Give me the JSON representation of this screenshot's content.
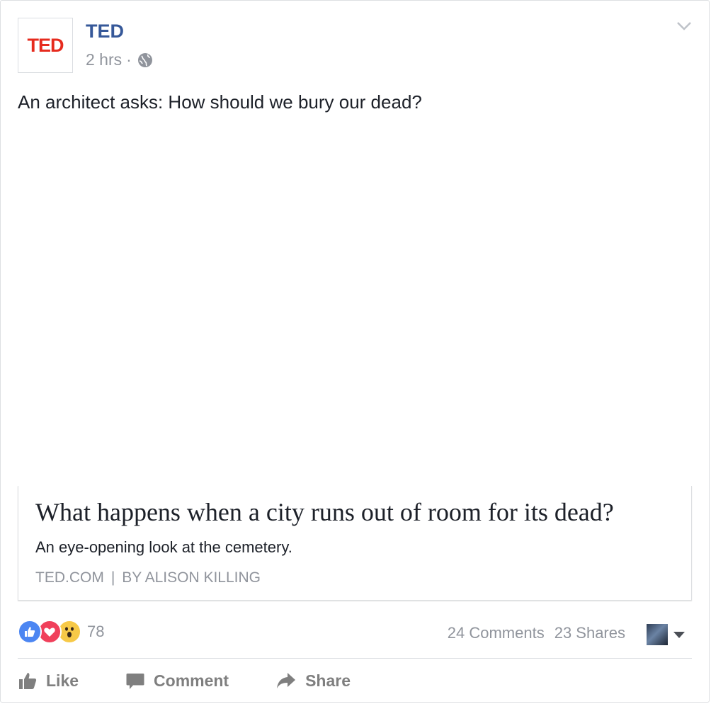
{
  "post": {
    "page_name": "TED",
    "avatar_text": "TED",
    "timestamp": "2 hrs",
    "separator": "·",
    "privacy_icon": "globe-icon",
    "options_icon": "chevron-down-icon",
    "text": "An architect asks: How should we bury our dead?"
  },
  "link_preview": {
    "title": "What happens when a city runs out of room for its dead?",
    "description": "An eye-opening look at the cemetery.",
    "domain": "TED.COM",
    "separator": "|",
    "byline": "BY ALISON KILLING"
  },
  "engagement": {
    "reaction_icons": [
      "like-reaction-icon",
      "love-reaction-icon",
      "wow-reaction-icon"
    ],
    "reaction_count": "78",
    "comments": "24 Comments",
    "shares": "23 Shares"
  },
  "actions": {
    "like": "Like",
    "comment": "Comment",
    "share": "Share"
  },
  "colors": {
    "link_blue": "#365899",
    "ted_red": "#e62b1e",
    "meta_gray": "#90949c",
    "like_blue": "#4c86f2",
    "love_red": "#f0405b",
    "wow_yellow": "#f7c947"
  }
}
